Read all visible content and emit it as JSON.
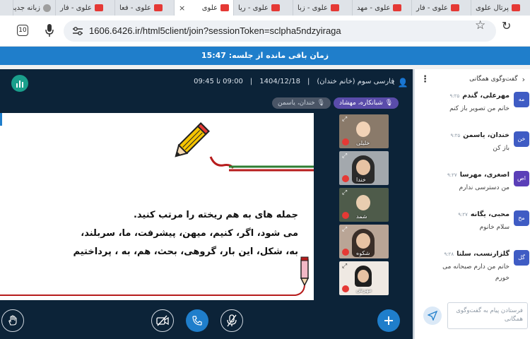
{
  "browser": {
    "tabs": [
      {
        "label": "پرتال علوی",
        "favicon": "red",
        "active": false
      },
      {
        "label": "علوی - فار",
        "favicon": "red",
        "active": false
      },
      {
        "label": "علوی - مهد",
        "favicon": "red",
        "active": false
      },
      {
        "label": "علوی - زبا",
        "favicon": "red",
        "active": false
      },
      {
        "label": "علوی - ریا",
        "favicon": "red",
        "active": false
      },
      {
        "label": "علوی",
        "favicon": "red",
        "active": true
      },
      {
        "label": "علوی - فعا",
        "favicon": "red",
        "active": false
      },
      {
        "label": "علوی - فار",
        "favicon": "red",
        "active": false
      },
      {
        "label": "زبانه جدید",
        "favicon": "gray",
        "active": false
      }
    ],
    "tab_close_glyph": "×",
    "tab_count_badge": "10",
    "url": "1606.6426.ir/html5client/join?sessionToken=sclpha5ndzyiraga"
  },
  "timer": {
    "label": "زمان باقی مانده از جلسه:",
    "value": "15:47"
  },
  "session": {
    "title": "فارسی سوم (خانم خندان)",
    "date": "1404/12/18",
    "time": "09:00 تا 09:45"
  },
  "presenters": {
    "speaker": "شبانکاره، مهشاد",
    "listener": "خندان، یاسمن"
  },
  "slide": {
    "line1": "جمله های به هم ریخته را مرتب کنید.",
    "line2": "می شود، اگر، کنیم، میهن، پیشرفت، ما، سربلند،",
    "line3": "به، شکل، این بار، گروهی، بحث، هم، به ، پرداختیم"
  },
  "cameras": [
    {
      "name": "خلیلی"
    },
    {
      "name": "خندا"
    },
    {
      "name": "شمد"
    },
    {
      "name": "شکوه"
    },
    {
      "name": "مهرش"
    }
  ],
  "chat": {
    "title": "گفت‌وگوی همگانی",
    "input_placeholder": "فرستادن پیام به گفت‌وگوی همگانی",
    "messages": [
      {
        "initials": "مه",
        "name": "مهرعلی، گندم",
        "time": "۹:۲۵",
        "body": "خانم من تصویر باز کنم",
        "color": "#3f5cc4"
      },
      {
        "initials": "خن",
        "name": "خندان، یاسمن",
        "time": "۹:۲۵",
        "body": "باز کن",
        "color": "#3f5cc4"
      },
      {
        "initials": "اص",
        "name": "اصغری، مهرسا",
        "time": "۹:۲۷",
        "body": "من دسترسی ندارم",
        "color": "#5b3fb8"
      },
      {
        "initials": "مح",
        "name": "محبی، یگانه",
        "time": "۹:۲۷",
        "body": "سلام خانوم",
        "color": "#3f5cc4"
      },
      {
        "initials": "گل",
        "name": "گلزارنسب، سلنا",
        "time": "۹:۲۸",
        "body": "خانم من دارم صبحانه می خورم",
        "color": "#3f5cc4"
      }
    ]
  },
  "colors": {
    "accent": "#1f7ecb",
    "meeting_bg": "#0c2338",
    "speaker_chip": "#5a4caa",
    "brand": "#1a9f8c"
  }
}
